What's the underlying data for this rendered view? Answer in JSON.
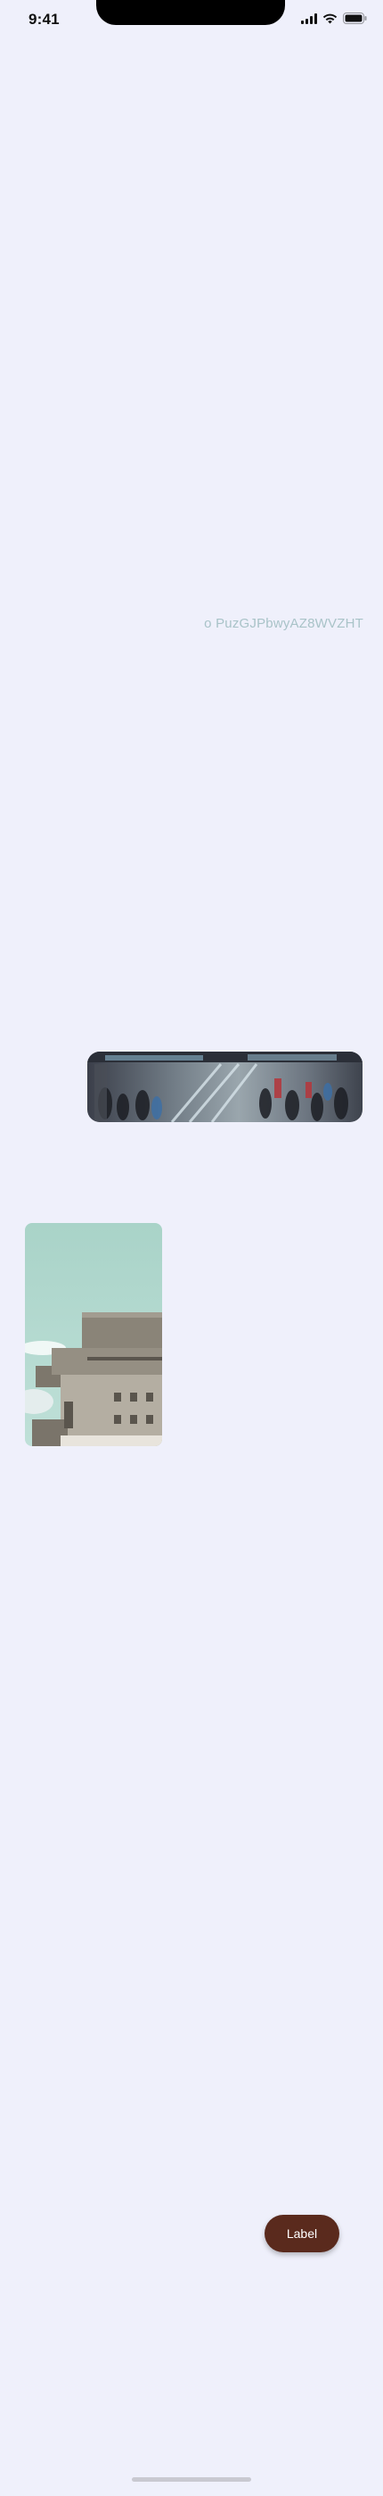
{
  "status_bar": {
    "time": "9:41",
    "icons": [
      "cellular-signal-icon",
      "wifi-icon",
      "battery-icon"
    ]
  },
  "content": {
    "faint_text": "o PuzGJPbwyAZ8WVZHT",
    "images": [
      {
        "name": "crowd-escalator-photo"
      },
      {
        "name": "concrete-building-photo"
      }
    ]
  },
  "fab": {
    "label": "Label"
  },
  "colors": {
    "background": "#eff0fb",
    "fab": "#5a2a1d",
    "faint_text": "#a9c3c8"
  }
}
